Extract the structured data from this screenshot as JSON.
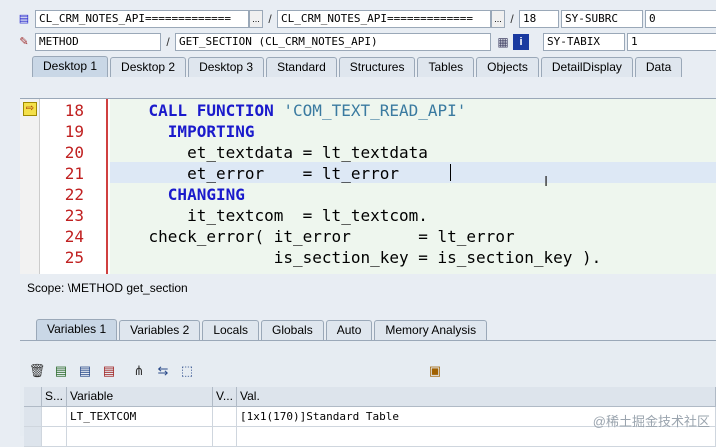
{
  "header": {
    "program_field": "CL_CRM_NOTES_API=============",
    "program_dropdown": "...",
    "include_field": "CL_CRM_NOTES_API=============",
    "include_dropdown": "...",
    "line_no": "18",
    "sysvar1_name": "SY-SUBRC",
    "sysvar1_value": "0",
    "event_type": "METHOD",
    "event_name": "GET_SECTION (CL_CRM_NOTES_API)",
    "sysvar2_name": "SY-TABIX",
    "sysvar2_value": "1"
  },
  "desktop_tabs": [
    "Desktop 1",
    "Desktop 2",
    "Desktop 3",
    "Standard",
    "Structures",
    "Tables",
    "Objects",
    "DetailDisplay",
    "Data"
  ],
  "code": {
    "line_numbers": [
      "18",
      "19",
      "20",
      "21",
      "22",
      "23",
      "24",
      "25"
    ],
    "lines": [
      [
        {
          "t": "    "
        },
        {
          "k": "CALL FUNCTION"
        },
        {
          "t": " "
        },
        {
          "s": "'COM_TEXT_READ_API'"
        }
      ],
      [
        {
          "t": "      "
        },
        {
          "k": "IMPORTING"
        }
      ],
      [
        {
          "t": "        et_textdata = lt_textdata"
        }
      ],
      [
        {
          "t": "        et_error    = lt_error"
        }
      ],
      [
        {
          "t": "      "
        },
        {
          "k": "CHANGING"
        }
      ],
      [
        {
          "t": "        it_textcom  = lt_textcom."
        }
      ],
      [
        {
          "t": "    check_error( it_error       = lt_error"
        }
      ],
      [
        {
          "t": "                 is_section_key = is_section_key )."
        }
      ]
    ]
  },
  "scope_text": "Scope: \\METHOD get_section",
  "var_tabs": [
    "Variables 1",
    "Variables 2",
    "Locals",
    "Globals",
    "Auto",
    "Memory Analysis"
  ],
  "grid": {
    "headers": [
      "S...",
      "Variable",
      "V...",
      "Val."
    ],
    "rows": [
      {
        "variable": "LT_TEXTCOM",
        "value": "[1x1(170)]Standard Table"
      },
      {
        "variable": "",
        "value": ""
      }
    ]
  },
  "watermark": "@稀土掘金技术社区",
  "colors": {
    "keyword": "#1a1acc",
    "line_number": "#c02020",
    "string": "#3a7aa0"
  }
}
